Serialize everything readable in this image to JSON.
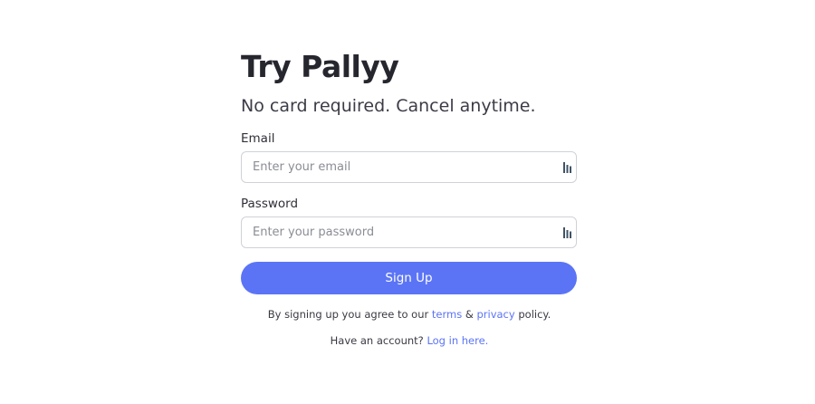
{
  "heading": {
    "title": "Try Pallyy",
    "subtitle": "No card required. Cancel anytime."
  },
  "form": {
    "email": {
      "label": "Email",
      "placeholder": "Enter your email",
      "value": ""
    },
    "password": {
      "label": "Password",
      "placeholder": "Enter your password",
      "value": ""
    },
    "submit_label": "Sign Up"
  },
  "legal": {
    "prefix": "By signing up you agree to our ",
    "terms_link": "terms",
    "ampersand": " & ",
    "privacy_link": "privacy",
    "suffix": " policy."
  },
  "account": {
    "prompt": "Have an account? ",
    "login_link": "Log in here."
  },
  "colors": {
    "accent": "#5b74f6",
    "input_border": "#cfd2d8",
    "password_manager_icon": "#3f5366"
  },
  "icons": {
    "field_icon": "password-manager-icon"
  }
}
